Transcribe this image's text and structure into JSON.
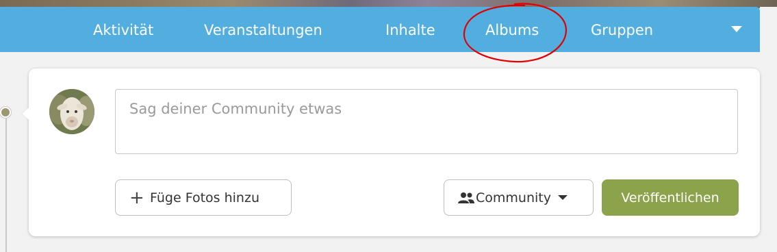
{
  "nav": {
    "items": [
      "Aktivität",
      "Veranstaltungen",
      "Inhalte",
      "Albums",
      "Gruppen"
    ],
    "dropdown_icon": "chevron-down-icon",
    "background_color": "#51aedf",
    "highlighted_item": "Albums",
    "highlight_color": "#e00000"
  },
  "composer": {
    "placeholder": "Sag deiner Community etwas",
    "add_photos_label": "Füge Fotos hinzu",
    "add_photos_icon": "plus-icon",
    "audience_label": "Community",
    "audience_icon": "people-icon",
    "publish_label": "Veröffentlichen",
    "publish_color": "#8ba34a"
  }
}
